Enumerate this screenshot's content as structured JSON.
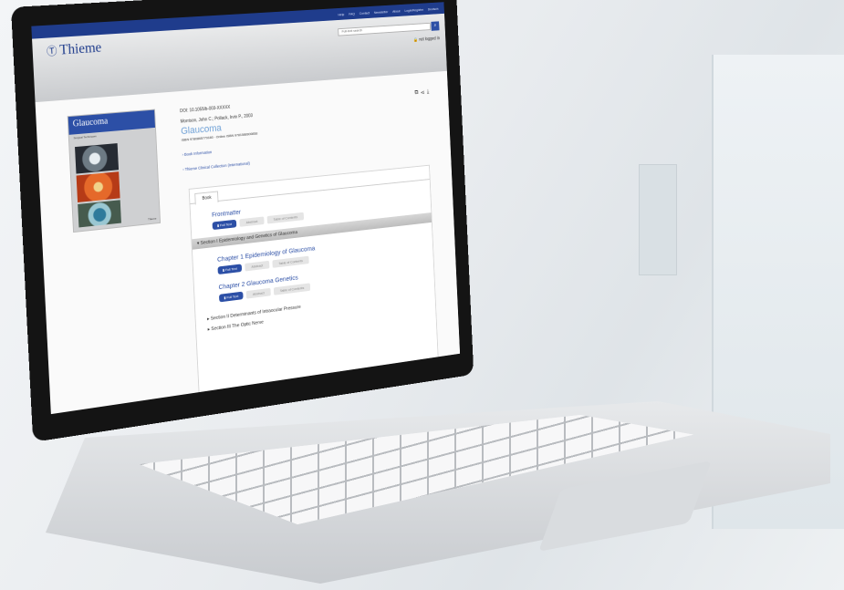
{
  "top_nav": [
    "Help",
    "FAQ",
    "Contact",
    "Newsletter",
    "About",
    "Login/Register",
    "Deutsch"
  ],
  "logo": {
    "mark": "Ⓣ",
    "name": "Thieme"
  },
  "search": {
    "placeholder": "Full-text search"
  },
  "login_status": "not logged in",
  "book_cover": {
    "title": "Glaucoma",
    "subtitle": "Surgical Techniques",
    "publisher": "Thieme"
  },
  "meta": {
    "doi": "DOI: 10.1055/b-003-XXXXX",
    "authors": "Morrison, John C.; Pollack, Irvin P., 2003",
    "title": "Glaucoma",
    "isbn": "ISBN 9780865779180 · Online ISBN 9781588900858"
  },
  "links": [
    "Book Information",
    "Thieme Clinical Collection (International)"
  ],
  "tabs": [
    "Book"
  ],
  "toc": {
    "frontmatter": "Frontmatter",
    "full_text_label": "Full Text",
    "pdf_label": "Abstract",
    "alt_label": "Table of Contents",
    "section1": "Section I Epidemiology and Genetics of Glaucoma",
    "chapters": [
      "Chapter 1 Epidemiology of Glaucoma",
      "Chapter 2 Glaucoma Genetics"
    ],
    "section2": "Section II Determinants of Intraocular Pressure",
    "section3": "Section III The Optic Nerve"
  }
}
